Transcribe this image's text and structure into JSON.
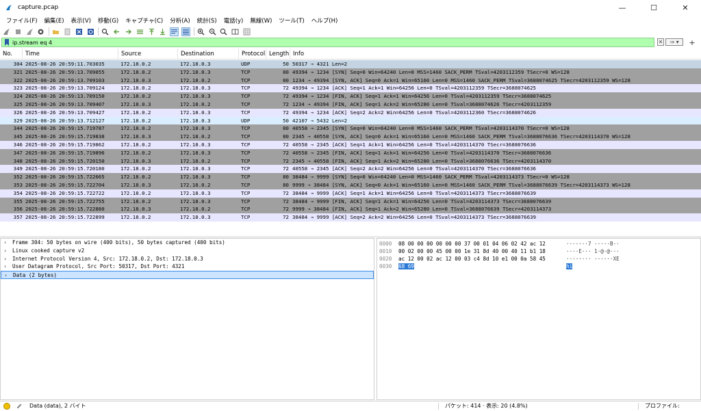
{
  "window": {
    "title": "capture.pcap",
    "minimize": "—",
    "maximize": "☐",
    "close": "✕"
  },
  "menu": [
    "ファイル(F)",
    "編集(E)",
    "表示(V)",
    "移動(G)",
    "キャプチャ(C)",
    "分析(A)",
    "統計(S)",
    "電話(y)",
    "無線(W)",
    "ツール(T)",
    "ヘルプ(H)"
  ],
  "filter": {
    "value": "ip.stream eq 4",
    "clear_label": "✕",
    "apply_label": "⇒ ▾",
    "add_label": "+"
  },
  "packet_list": {
    "columns": [
      "No.",
      "Time",
      "Source",
      "Destination",
      "Protocol",
      "Length",
      "Info"
    ],
    "rows": [
      {
        "no": "304",
        "time": "2025-08-26 20:59:11.703035",
        "src": "172.18.0.2",
        "dst": "172.18.0.3",
        "proto": "UDP",
        "len": "50",
        "info": "50317 → 4321 Len=2",
        "bg": "#c4d4e2"
      },
      {
        "no": "321",
        "time": "2025-08-26 20:59:13.709055",
        "src": "172.18.0.2",
        "dst": "172.18.0.3",
        "proto": "TCP",
        "len": "80",
        "info": "49394 → 1234 [SYN] Seq=0 Win=64240 Len=0 MSS=1460 SACK_PERM TSval=4203112359 TSecr=0 WS=128",
        "bg": "#a0a0a0"
      },
      {
        "no": "322",
        "time": "2025-08-26 20:59:13.709103",
        "src": "172.18.0.3",
        "dst": "172.18.0.2",
        "proto": "TCP",
        "len": "80",
        "info": "1234 → 49394 [SYN, ACK] Seq=0 Ack=1 Win=65160 Len=0 MSS=1460 SACK_PERM TSval=3688074625 TSecr=4203112359 WS=128",
        "bg": "#a0a0a0"
      },
      {
        "no": "323",
        "time": "2025-08-26 20:59:13.709124",
        "src": "172.18.0.2",
        "dst": "172.18.0.3",
        "proto": "TCP",
        "len": "72",
        "info": "49394 → 1234 [ACK] Seq=1 Ack=1 Win=64256 Len=0 TSval=4203112359 TSecr=3688074625",
        "bg": "#e7e6ff"
      },
      {
        "no": "324",
        "time": "2025-08-26 20:59:13.709150",
        "src": "172.18.0.2",
        "dst": "172.18.0.3",
        "proto": "TCP",
        "len": "72",
        "info": "49394 → 1234 [FIN, ACK] Seq=1 Ack=1 Win=64256 Len=0 TSval=4203112359 TSecr=3688074625",
        "bg": "#a0a0a0"
      },
      {
        "no": "325",
        "time": "2025-08-26 20:59:13.709407",
        "src": "172.18.0.3",
        "dst": "172.18.0.2",
        "proto": "TCP",
        "len": "72",
        "info": "1234 → 49394 [FIN, ACK] Seq=1 Ack=2 Win=65280 Len=0 TSval=3688074626 TSecr=4203112359",
        "bg": "#a0a0a0"
      },
      {
        "no": "326",
        "time": "2025-08-26 20:59:13.709427",
        "src": "172.18.0.2",
        "dst": "172.18.0.3",
        "proto": "TCP",
        "len": "72",
        "info": "49394 → 1234 [ACK] Seq=2 Ack=2 Win=64256 Len=0 TSval=4203112360 TSecr=3688074626",
        "bg": "#e7e6ff"
      },
      {
        "no": "329",
        "time": "2025-08-26 20:59:13.712127",
        "src": "172.18.0.2",
        "dst": "172.18.0.3",
        "proto": "UDP",
        "len": "50",
        "info": "42107 → 5432 Len=2",
        "bg": "#daeeff"
      },
      {
        "no": "344",
        "time": "2025-08-26 20:59:15.719787",
        "src": "172.18.0.2",
        "dst": "172.18.0.3",
        "proto": "TCP",
        "len": "80",
        "info": "40558 → 2345 [SYN] Seq=0 Win=64240 Len=0 MSS=1460 SACK_PERM TSval=4203114370 TSecr=0 WS=128",
        "bg": "#a0a0a0"
      },
      {
        "no": "345",
        "time": "2025-08-26 20:59:15.719838",
        "src": "172.18.0.3",
        "dst": "172.18.0.2",
        "proto": "TCP",
        "len": "80",
        "info": "2345 → 40558 [SYN, ACK] Seq=0 Ack=1 Win=65160 Len=0 MSS=1460 SACK_PERM TSval=3688076636 TSecr=4203114370 WS=128",
        "bg": "#a0a0a0"
      },
      {
        "no": "346",
        "time": "2025-08-26 20:59:15.719862",
        "src": "172.18.0.2",
        "dst": "172.18.0.3",
        "proto": "TCP",
        "len": "72",
        "info": "40558 → 2345 [ACK] Seq=1 Ack=1 Win=64256 Len=0 TSval=4203114370 TSecr=3688076636",
        "bg": "#e7e6ff"
      },
      {
        "no": "347",
        "time": "2025-08-26 20:59:15.719896",
        "src": "172.18.0.2",
        "dst": "172.18.0.3",
        "proto": "TCP",
        "len": "72",
        "info": "40558 → 2345 [FIN, ACK] Seq=1 Ack=1 Win=64256 Len=0 TSval=4203114370 TSecr=3688076636",
        "bg": "#a0a0a0"
      },
      {
        "no": "348",
        "time": "2025-08-26 20:59:15.720150",
        "src": "172.18.0.3",
        "dst": "172.18.0.2",
        "proto": "TCP",
        "len": "72",
        "info": "2345 → 40558 [FIN, ACK] Seq=1 Ack=2 Win=65280 Len=0 TSval=3688076636 TSecr=4203114370",
        "bg": "#a0a0a0"
      },
      {
        "no": "349",
        "time": "2025-08-26 20:59:15.720180",
        "src": "172.18.0.2",
        "dst": "172.18.0.3",
        "proto": "TCP",
        "len": "72",
        "info": "40558 → 2345 [ACK] Seq=2 Ack=2 Win=64256 Len=0 TSval=4203114370 TSecr=3688076636",
        "bg": "#e7e6ff"
      },
      {
        "no": "352",
        "time": "2025-08-26 20:59:15.722665",
        "src": "172.18.0.2",
        "dst": "172.18.0.3",
        "proto": "TCP",
        "len": "80",
        "info": "38484 → 9999 [SYN] Seq=0 Win=64240 Len=0 MSS=1460 SACK_PERM TSval=4203114373 TSecr=0 WS=128",
        "bg": "#a0a0a0"
      },
      {
        "no": "353",
        "time": "2025-08-26 20:59:15.722704",
        "src": "172.18.0.3",
        "dst": "172.18.0.2",
        "proto": "TCP",
        "len": "80",
        "info": "9999 → 38484 [SYN, ACK] Seq=0 Ack=1 Win=65160 Len=0 MSS=1460 SACK_PERM TSval=3688076639 TSecr=4203114373 WS=128",
        "bg": "#a0a0a0"
      },
      {
        "no": "354",
        "time": "2025-08-26 20:59:15.722722",
        "src": "172.18.0.2",
        "dst": "172.18.0.3",
        "proto": "TCP",
        "len": "72",
        "info": "38484 → 9999 [ACK] Seq=1 Ack=1 Win=64256 Len=0 TSval=4203114373 TSecr=3688076639",
        "bg": "#e7e6ff"
      },
      {
        "no": "355",
        "time": "2025-08-26 20:59:15.722755",
        "src": "172.18.0.2",
        "dst": "172.18.0.3",
        "proto": "TCP",
        "len": "72",
        "info": "38484 → 9999 [FIN, ACK] Seq=1 Ack=1 Win=64256 Len=0 TSval=4203114373 TSecr=3688076639",
        "bg": "#a0a0a0"
      },
      {
        "no": "356",
        "time": "2025-08-26 20:59:15.722880",
        "src": "172.18.0.3",
        "dst": "172.18.0.2",
        "proto": "TCP",
        "len": "72",
        "info": "9999 → 38484 [FIN, ACK] Seq=1 Ack=2 Win=65280 Len=0 TSval=3688076639 TSecr=4203114373",
        "bg": "#a0a0a0"
      },
      {
        "no": "357",
        "time": "2025-08-26 20:59:15.722899",
        "src": "172.18.0.2",
        "dst": "172.18.0.3",
        "proto": "TCP",
        "len": "72",
        "info": "38484 → 9999 [ACK] Seq=2 Ack=2 Win=64256 Len=0 TSval=4203114373 TSecr=3688076639",
        "bg": "#e7e6ff"
      }
    ]
  },
  "details": {
    "rows": [
      {
        "text": "Frame 304: 50 bytes on wire (400 bits), 50 bytes captured (400 bits)",
        "selected": false
      },
      {
        "text": "Linux cooked capture v2",
        "selected": false
      },
      {
        "text": "Internet Protocol Version 4, Src: 172.18.0.2, Dst: 172.18.0.3",
        "selected": false
      },
      {
        "text": "User Datagram Protocol, Src Port: 50317, Dst Port: 4321",
        "selected": false
      },
      {
        "text": "Data (2 bytes)",
        "selected": true
      }
    ]
  },
  "bytes": {
    "rows": [
      {
        "offset": "0000",
        "hex": "08 00 00 00 00 00 00 37  00 01 04 06 02 42 ac 12",
        "ascii": "·······7 ·····B··",
        "hl_hex": "",
        "hl_ascii": ""
      },
      {
        "offset": "0010",
        "hex": "00 02 00 00 45 00 00 1e  31 8d 40 00 40 11 b1 18",
        "ascii": "····E··· 1·@·@···",
        "hl_hex": "",
        "hl_ascii": ""
      },
      {
        "offset": "0020",
        "hex": "ac 12 00 02 ac 12 00 03  c4 8d 10 e1 00 0a 58 45",
        "ascii": "········ ······XE",
        "hl_hex": "",
        "hl_ascii": ""
      },
      {
        "offset": "0030",
        "hex": "",
        "ascii": "",
        "hl_hex": "68 69",
        "hl_ascii": "hi"
      }
    ]
  },
  "status": {
    "left": "Data (data), 2 バイト",
    "mid": "パケット: 414 · 表示: 20 (4.8%)",
    "right": "プロファイル: Default"
  },
  "colors": {
    "filter_bg": "#afffaf",
    "selection": "#2a79d6"
  }
}
